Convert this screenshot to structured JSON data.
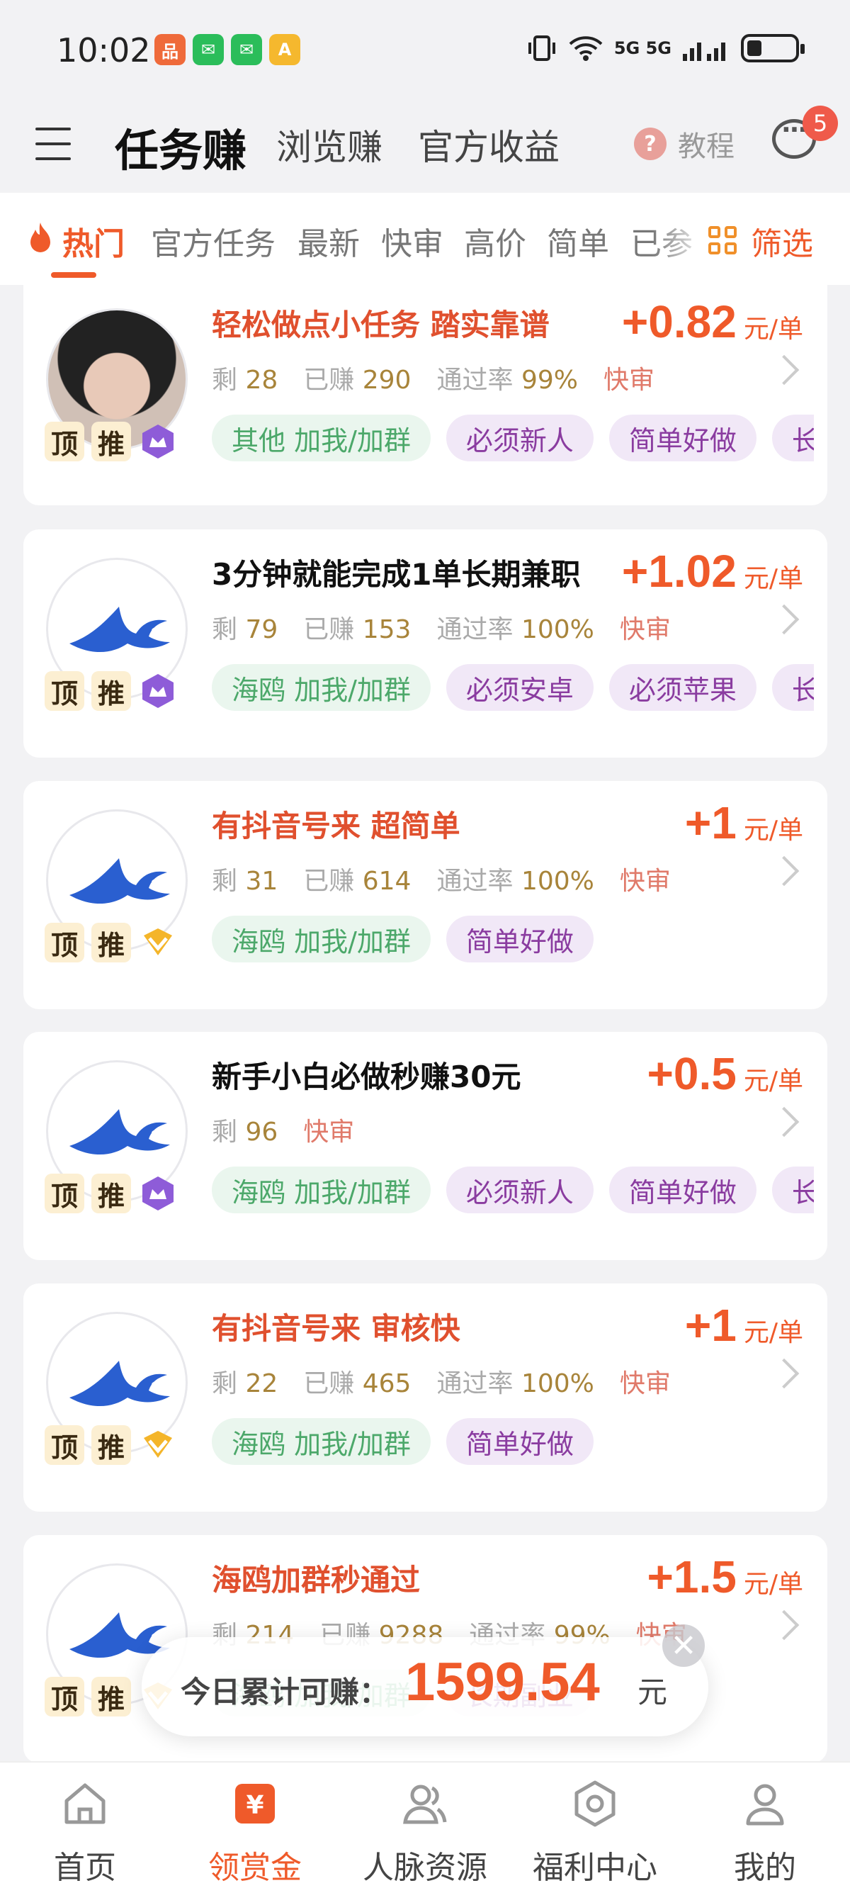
{
  "status_bar": {
    "time": "10:02",
    "app_icons": [
      {
        "name": "shopping-app-icon",
        "color": "#ef6a3a",
        "glyph": "品"
      },
      {
        "name": "wechat-icon",
        "color": "#2bbd5a",
        "glyph": "✉"
      },
      {
        "name": "wechat-icon-2",
        "color": "#2bbd5a",
        "glyph": "✉"
      },
      {
        "name": "game-app-icon",
        "color": "#f5b82e",
        "glyph": "A"
      }
    ],
    "network": "5G 5G"
  },
  "header": {
    "tabs": [
      {
        "label": "任务赚",
        "active": true
      },
      {
        "label": "浏览赚",
        "active": false
      },
      {
        "label": "官方收益",
        "active": false
      }
    ],
    "help_label": "教程",
    "help_glyph": "?",
    "message_badge": "5"
  },
  "filters": {
    "items": [
      "热门",
      "官方任务",
      "最新",
      "快审",
      "高价",
      "简单",
      "已参"
    ],
    "active": "热门",
    "filter_label": "筛选"
  },
  "tasks": [
    {
      "title": "轻松做点小任务 踏实靠谱",
      "title_color": "red",
      "price": "+0.82",
      "unit": "元/单",
      "remaining": "28",
      "earned": "290",
      "pass_rate": "99%",
      "fast": "快审",
      "tags": [
        {
          "text": "其他 加我/加群",
          "style": "green"
        },
        {
          "text": "必须新人",
          "style": "purple"
        },
        {
          "text": "简单好做",
          "style": "purple"
        },
        {
          "text": "长期",
          "style": "purple"
        }
      ],
      "avatar": "photo",
      "level": "purple"
    },
    {
      "title": "3分钟就能完成1单长期兼职",
      "title_color": "black",
      "price": "+1.02",
      "unit": "元/单",
      "remaining": "79",
      "earned": "153",
      "pass_rate": "100%",
      "fast": "快审",
      "tags": [
        {
          "text": "海鸥 加我/加群",
          "style": "green"
        },
        {
          "text": "必须安卓",
          "style": "purple"
        },
        {
          "text": "必须苹果",
          "style": "purple"
        },
        {
          "text": "长期",
          "style": "purple"
        }
      ],
      "avatar": "bird",
      "level": "purple"
    },
    {
      "title": "有抖音号来 超简单",
      "title_color": "red",
      "price": "+1",
      "unit": "元/单",
      "remaining": "31",
      "earned": "614",
      "pass_rate": "100%",
      "fast": "快审",
      "tags": [
        {
          "text": "海鸥 加我/加群",
          "style": "green"
        },
        {
          "text": "简单好做",
          "style": "purple"
        }
      ],
      "avatar": "bird",
      "level": "gold"
    },
    {
      "title": "新手小白必做秒赚30元",
      "title_color": "black",
      "price": "+0.5",
      "unit": "元/单",
      "remaining": "96",
      "earned": "",
      "pass_rate": "",
      "fast": "快审",
      "tags": [
        {
          "text": "海鸥 加我/加群",
          "style": "green"
        },
        {
          "text": "必须新人",
          "style": "purple"
        },
        {
          "text": "简单好做",
          "style": "purple"
        },
        {
          "text": "长期",
          "style": "purple"
        }
      ],
      "avatar": "bird",
      "level": "purple"
    },
    {
      "title": "有抖音号来 审核快",
      "title_color": "red",
      "price": "+1",
      "unit": "元/单",
      "remaining": "22",
      "earned": "465",
      "pass_rate": "100%",
      "fast": "快审",
      "tags": [
        {
          "text": "海鸥 加我/加群",
          "style": "green"
        },
        {
          "text": "简单好做",
          "style": "purple"
        }
      ],
      "avatar": "bird",
      "level": "gold"
    },
    {
      "title": "海鸥加群秒通过",
      "title_color": "red",
      "price": "+1.5",
      "unit": "元/单",
      "remaining": "214",
      "earned": "9288",
      "pass_rate": "99%",
      "fast": "快审",
      "tags": [
        {
          "text": "海鸥 加我/加群",
          "style": "green"
        },
        {
          "text": "长期副业",
          "style": "purple"
        }
      ],
      "avatar": "bird",
      "level": "gold"
    }
  ],
  "labels": {
    "remaining": "剩",
    "earned": "已赚",
    "pass_rate": "通过率",
    "badge_top": "顶",
    "badge_push": "推"
  },
  "toast": {
    "label": "今日累计可赚：",
    "value": "1599.54",
    "unit": "元",
    "close_glyph": "✕"
  },
  "bottom_nav": [
    {
      "label": "首页",
      "icon": "home-icon",
      "active": false
    },
    {
      "label": "领赏金",
      "icon": "reward-icon",
      "active": true
    },
    {
      "label": "人脉资源",
      "icon": "contacts-icon",
      "active": false
    },
    {
      "label": "福利中心",
      "icon": "welfare-icon",
      "active": false
    },
    {
      "label": "我的",
      "icon": "profile-icon",
      "active": false
    }
  ],
  "colors": {
    "accent": "#ef5a2a",
    "tag_green_bg": "#eaf6ee",
    "tag_purple_bg": "#f1e8f7"
  }
}
